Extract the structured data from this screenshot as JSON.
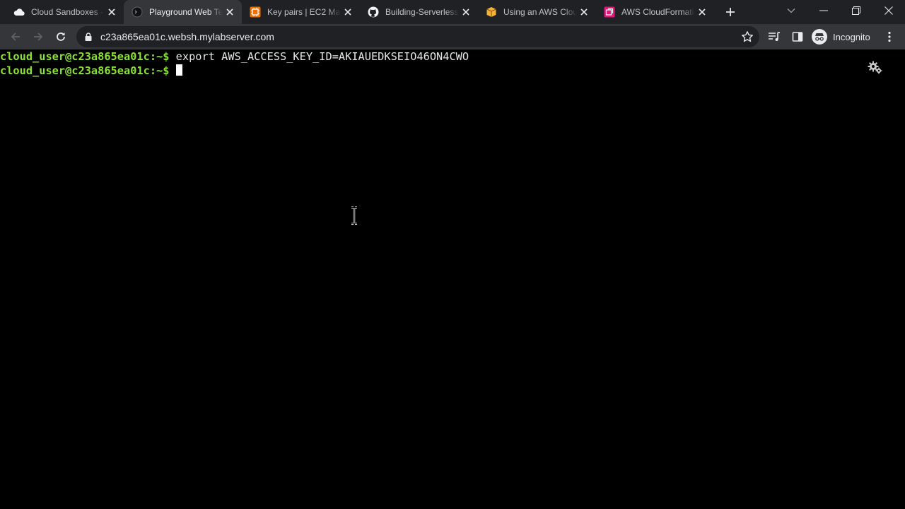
{
  "browser": {
    "tabs": [
      {
        "title": "Cloud Sandboxes - ",
        "favicon": "cloud-icon",
        "active": false
      },
      {
        "title": "Playground Web Te",
        "favicon": "terminal-circle-icon",
        "active": true
      },
      {
        "title": "Key pairs | EC2 Man",
        "favicon": "aws-ec2-icon",
        "active": false
      },
      {
        "title": "Building-Serverless",
        "favicon": "github-icon",
        "active": false
      },
      {
        "title": "Using an AWS Clou",
        "favicon": "aws-box-icon",
        "active": false
      },
      {
        "title": "AWS CloudFormatio",
        "favicon": "aws-cloudformation-icon",
        "active": false
      }
    ],
    "url": "c23a865ea01c.websh.mylabserver.com",
    "profile_label": "Incognito"
  },
  "terminal": {
    "lines": [
      {
        "prompt": "cloud_user@c23a865ea01c:~$",
        "command": " export AWS_ACCESS_KEY_ID=AKIAUEDKSEIO46ON4CWO"
      },
      {
        "prompt": "cloud_user@c23a865ea01c:~$",
        "command": " "
      }
    ],
    "prompt_color": "#8ae234",
    "background": "#000000"
  }
}
